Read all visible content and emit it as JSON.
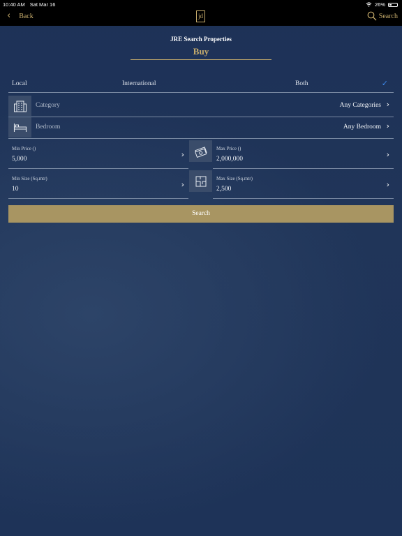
{
  "status": {
    "time": "10:40 AM",
    "date": "Sat Mar 16",
    "battery": "26%",
    "battery_level": 0.26
  },
  "nav": {
    "back_label": "Back",
    "logo_text": "jd",
    "search_label": "Search"
  },
  "page": {
    "title": "JRE Search Properties",
    "mode": "Buy"
  },
  "location_options": {
    "local": "Local",
    "international": "International",
    "both": "Both"
  },
  "category": {
    "label": "Category",
    "value": "Any Categories"
  },
  "bedroom": {
    "label": "Bedroom",
    "value": "Any Bedroom"
  },
  "price": {
    "min_label": "Min Price ()",
    "min_value": "5,000",
    "max_label": "Max Price ()",
    "max_value": "2,000,000"
  },
  "size": {
    "min_label": "Min Size (Sq.mtr)",
    "min_value": "10",
    "max_label": "Max Size (Sq.mtr)",
    "max_value": "2,500"
  },
  "search_button": "Search",
  "colors": {
    "accent": "#c8ad6c",
    "button": "#a89562",
    "background": "#1e3358",
    "check": "#3d8bf0"
  },
  "icons": {
    "category": "building-icon",
    "bedroom": "bed-icon",
    "price": "money-icon",
    "size": "floorplan-icon",
    "navsearch": "magnifier-icon"
  }
}
